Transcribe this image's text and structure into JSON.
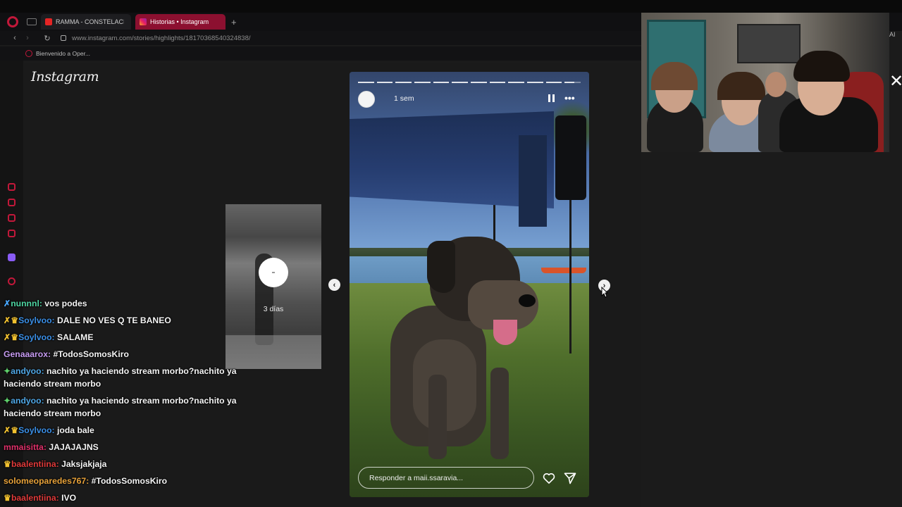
{
  "browser": {
    "tabs": [
      {
        "label": "RAMMA - CONSTELACIÓN",
        "icon": "youtube-icon"
      },
      {
        "label": "Historias • Instagram",
        "icon": "instagram-icon",
        "active": true
      }
    ],
    "new_tab": "+",
    "url": "www.instagram.com/stories/highlights/18170368540324838/",
    "bookmark": "Bienvenido a Oper...",
    "right_label": "AI"
  },
  "instagram": {
    "logo": "Instagram",
    "previous_story": {
      "time": "3 días"
    },
    "story": {
      "time": "1 sem",
      "progress_segments": 12,
      "progress_current": 11
    },
    "reply_placeholder": "Responder a maii.ssaravia...",
    "icons": {
      "heart": "heart-icon",
      "send": "send-icon",
      "pause": "pause-icon",
      "more": "more-icon"
    }
  },
  "colors": {
    "accent": "#c2183a",
    "active_tab": "#8c1030",
    "background": "#1a1a1a"
  },
  "chat": [
    {
      "badge": "sword",
      "user": "nunnnl",
      "color": "#4ed6a3",
      "text": "vos podes"
    },
    {
      "badge": "sword-crown",
      "user": "Soylvoo",
      "color": "#3b8fe6",
      "text": "DALE NO VES Q TE BANEO"
    },
    {
      "badge": "sword-crown",
      "user": "Soylvoo",
      "color": "#3b8fe6",
      "text": "SALAME"
    },
    {
      "badge": "",
      "user": "Genaaarox",
      "color": "#c79cf2",
      "text": "#TodosSomosKiro"
    },
    {
      "badge": "star",
      "user": "andyoo",
      "color": "#4fa7e6",
      "text": "nachito ya haciendo stream morbo?nachito ya haciendo stream morbo"
    },
    {
      "badge": "star",
      "user": "andyoo",
      "color": "#4fa7e6",
      "text": "nachito ya haciendo stream morbo?nachito ya haciendo stream morbo"
    },
    {
      "badge": "sword-crown",
      "user": "Soylvoo",
      "color": "#3b8fe6",
      "text": "joda bale"
    },
    {
      "badge": "",
      "user": "mmaisitta",
      "color": "#e0306a",
      "text": "JAJAJAJNS"
    },
    {
      "badge": "crown",
      "user": "baalentiina",
      "color": "#e03a3a",
      "text": "Jaksjakjaja"
    },
    {
      "badge": "",
      "user": "solomeoparedes767",
      "color": "#e8a23a",
      "text": "#TodosSomosKiro"
    },
    {
      "badge": "crown",
      "user": "baalentiina",
      "color": "#e03a3a",
      "text": "IVO"
    }
  ]
}
